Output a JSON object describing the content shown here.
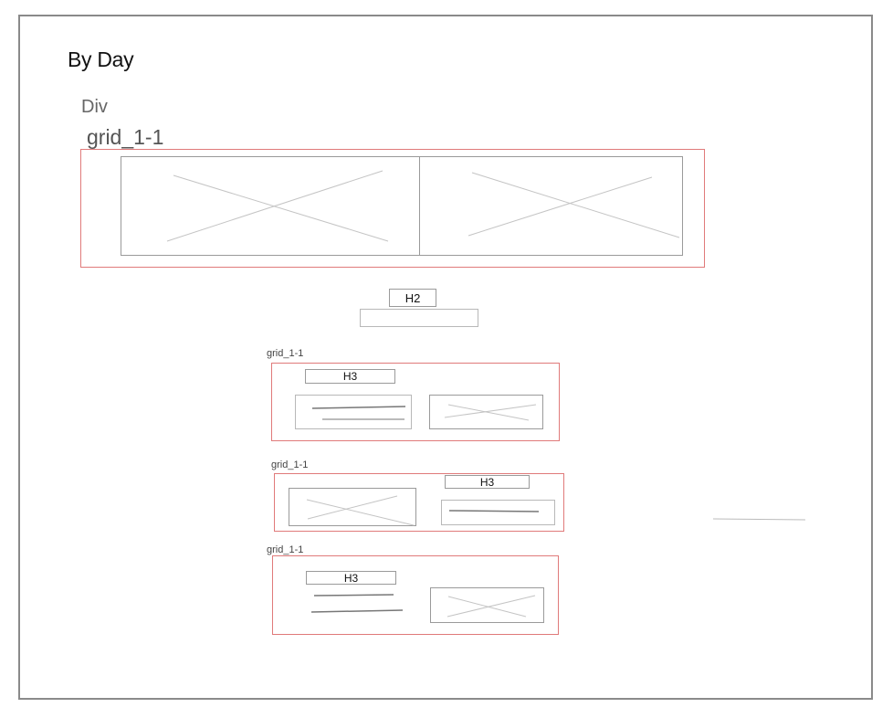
{
  "page": {
    "title": "By Day",
    "div_label": "Div"
  },
  "hero": {
    "grid_label": "grid_1-1"
  },
  "center": {
    "heading_label": "H2"
  },
  "sections": [
    {
      "grid_label": "grid_1-1",
      "heading_label": "H3"
    },
    {
      "grid_label": "grid_1-1",
      "heading_label": "H3"
    },
    {
      "grid_label": "grid_1-1",
      "heading_label": "H3"
    }
  ],
  "colors": {
    "frame_border": "#8a8a8a",
    "container_border": "#e07a7a",
    "placeholder_stroke": "#c4c4c4",
    "text_line": "#777777"
  }
}
